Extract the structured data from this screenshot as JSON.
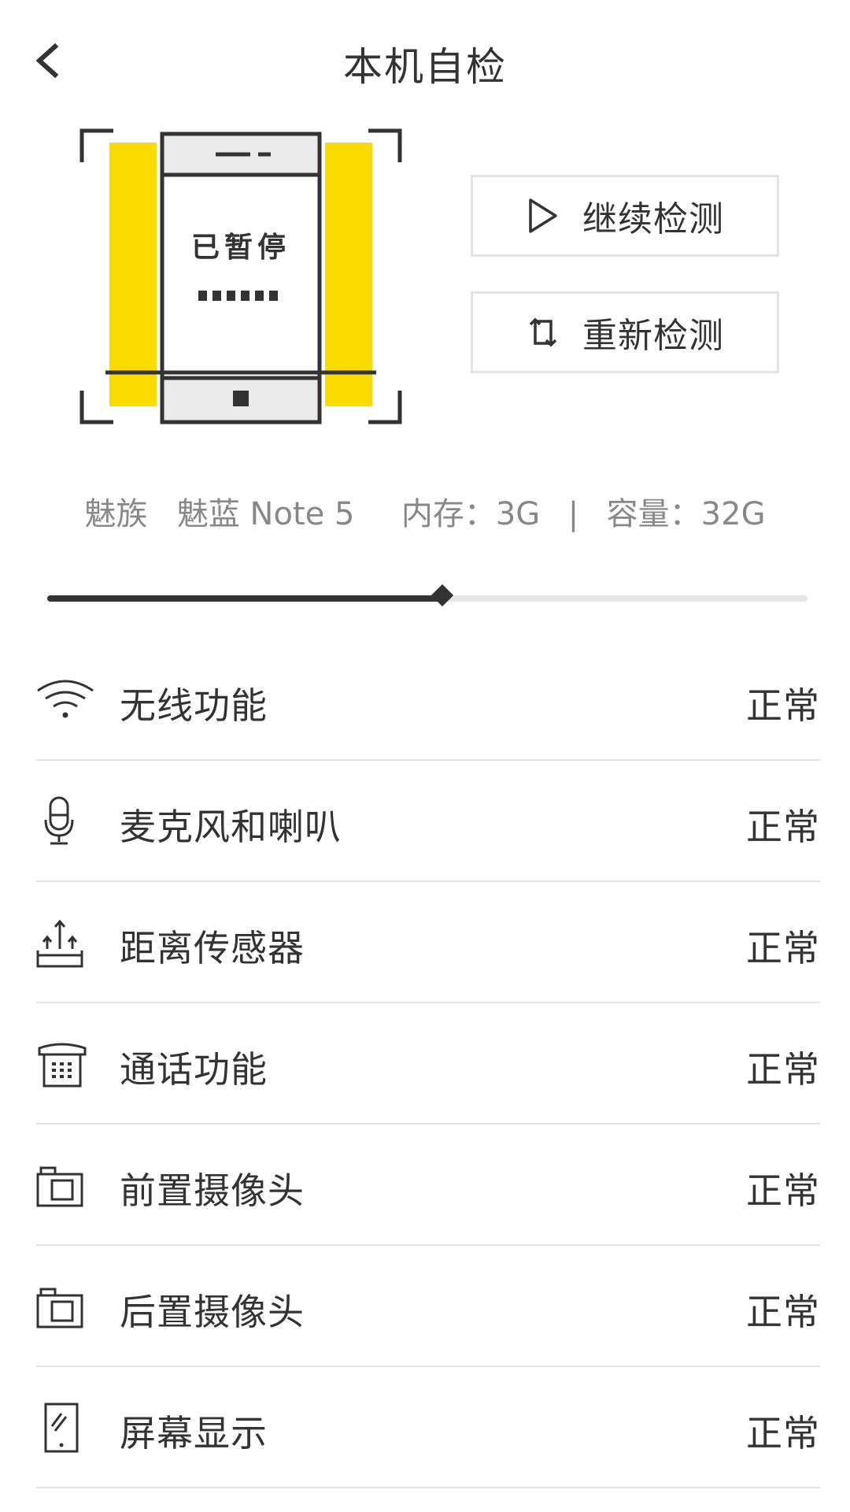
{
  "header": {
    "title": "本机自检"
  },
  "illustration": {
    "screen_text": "已暂停",
    "accent_color": "#FADB00"
  },
  "actions": {
    "continue_label": "继续检测",
    "restart_label": "重新检测"
  },
  "device": {
    "brand": "魅族",
    "model": "魅蓝 Note 5",
    "memory_label": "内存：3G",
    "separator": "|",
    "storage_label": "容量：32G"
  },
  "progress": {
    "fraction": 0.52
  },
  "checks": [
    {
      "label": "无线功能",
      "status": "正常",
      "icon": "wifi-icon"
    },
    {
      "label": "麦克风和喇叭",
      "status": "正常",
      "icon": "microphone-icon"
    },
    {
      "label": "距离传感器",
      "status": "正常",
      "icon": "proximity-sensor-icon"
    },
    {
      "label": "通话功能",
      "status": "正常",
      "icon": "telephone-icon"
    },
    {
      "label": "前置摄像头",
      "status": "正常",
      "icon": "front-camera-icon"
    },
    {
      "label": "后置摄像头",
      "status": "正常",
      "icon": "rear-camera-icon"
    },
    {
      "label": "屏幕显示",
      "status": "正常",
      "icon": "screen-icon"
    }
  ]
}
